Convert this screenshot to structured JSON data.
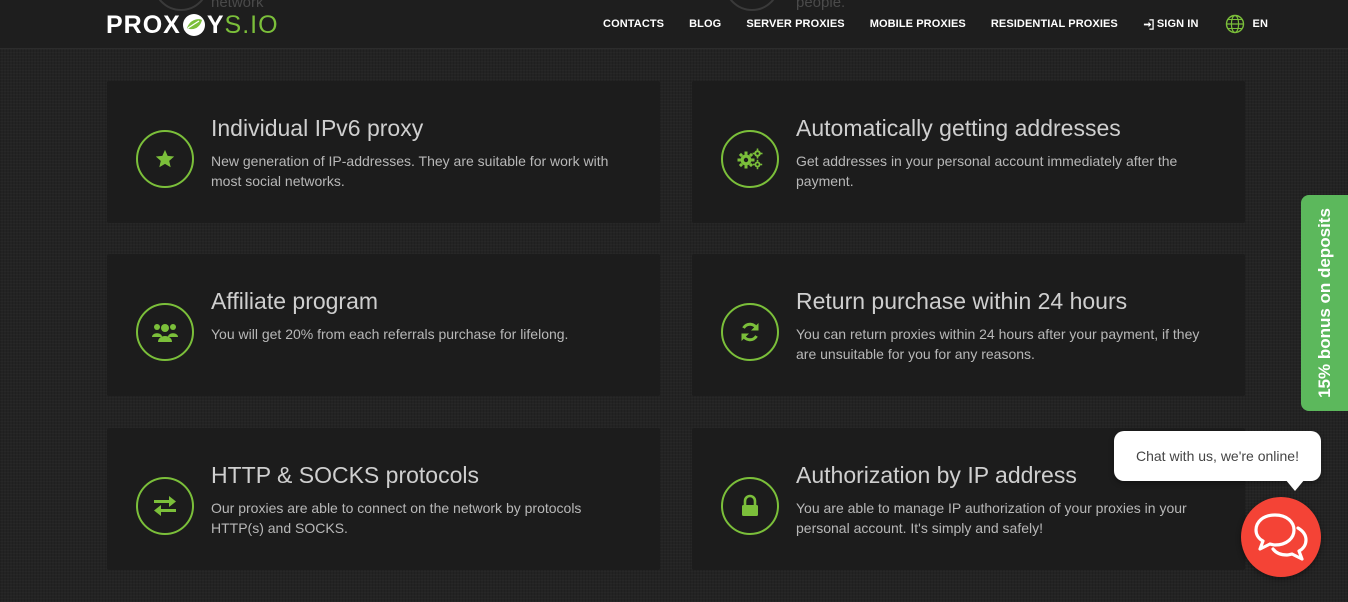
{
  "header": {
    "ghost_left": "network",
    "ghost_right": "people.",
    "logo": {
      "prox": "PROX",
      "y": "Y",
      "sio": "S.IO"
    },
    "nav": [
      "CONTACTS",
      "BLOG",
      "SERVER PROXIES",
      "MOBILE PROXIES",
      "RESIDENTIAL PROXIES"
    ],
    "sign_in": "SIGN IN",
    "lang": "EN"
  },
  "features": [
    {
      "title": "Individual IPv6 proxy",
      "text": "New generation of IP-addresses. They are suitable for work with most social networks.",
      "icon": "star-icon"
    },
    {
      "title": "Automatically getting addresses",
      "text": "Get addresses in your personal account immediately after the payment.",
      "icon": "gears-icon"
    },
    {
      "title": "Affiliate program",
      "text": "You will get 20% from each referrals purchase for lifelong.",
      "icon": "users-icon"
    },
    {
      "title": "Return purchase within 24 hours",
      "text": "You can return proxies within 24 hours after your payment, if they are unsuitable for you for any reasons.",
      "icon": "refresh-icon"
    },
    {
      "title": "HTTP & SOCKS protocols",
      "text": "Our proxies are able to connect on the network by protocols HTTP(s) and SOCKS.",
      "icon": "exchange-icon"
    },
    {
      "title": "Authorization by IP address",
      "text": "You are able to manage IP authorization of your proxies in your personal account. It's simply and safely!",
      "icon": "lock-icon"
    }
  ],
  "bonus_tab": {
    "label": "15% bonus on deposits"
  },
  "chat": {
    "message": "Chat with us, we're online!"
  },
  "colors": {
    "accent": "#7bbf3a",
    "bonus": "#5cb85c",
    "chat": "#f44336"
  }
}
